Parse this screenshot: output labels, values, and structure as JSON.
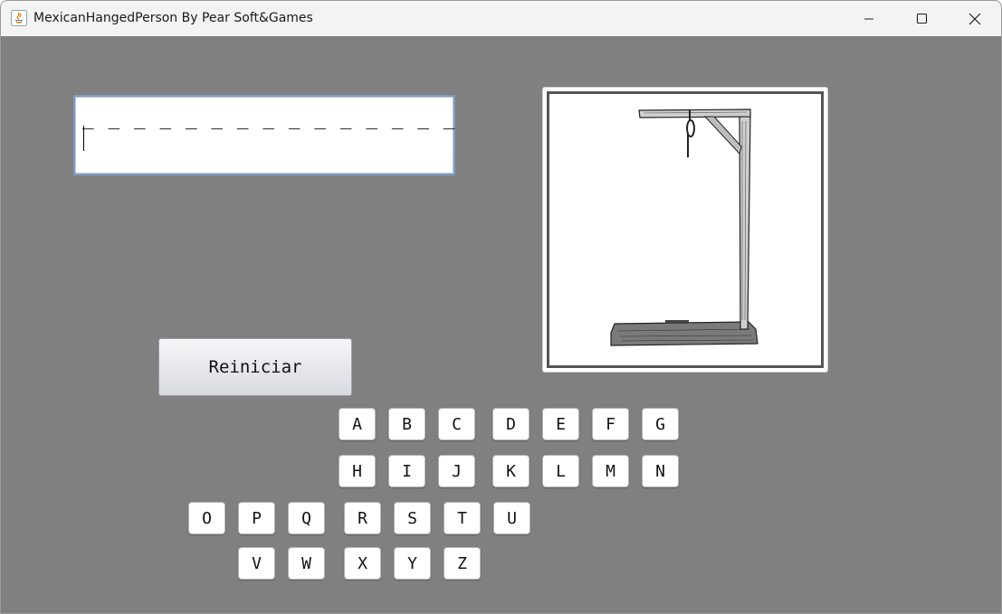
{
  "window": {
    "title": "MexicanHangedPerson By Pear Soft&Games",
    "controls": [
      "minimize",
      "maximize",
      "close"
    ]
  },
  "game": {
    "word_display": "_ _ _ _ _ _ _ _ _ _ _ _ _ _ _",
    "reset_label": "Reiniciar",
    "hangman_image": "gallows-empty"
  },
  "keyboard": {
    "rows": [
      [
        "A",
        "B",
        "C",
        "D",
        "E",
        "F",
        "G"
      ],
      [
        "H",
        "I",
        "J",
        "K",
        "L",
        "M",
        "N"
      ],
      [
        "O",
        "P",
        "Q",
        "R",
        "S",
        "T",
        "U"
      ],
      [
        "V",
        "W",
        "X",
        "Y",
        "Z"
      ]
    ]
  },
  "colors": {
    "background": "#808080",
    "titlebar": "#f3f3f3",
    "input_border": "#7d9cc0"
  }
}
